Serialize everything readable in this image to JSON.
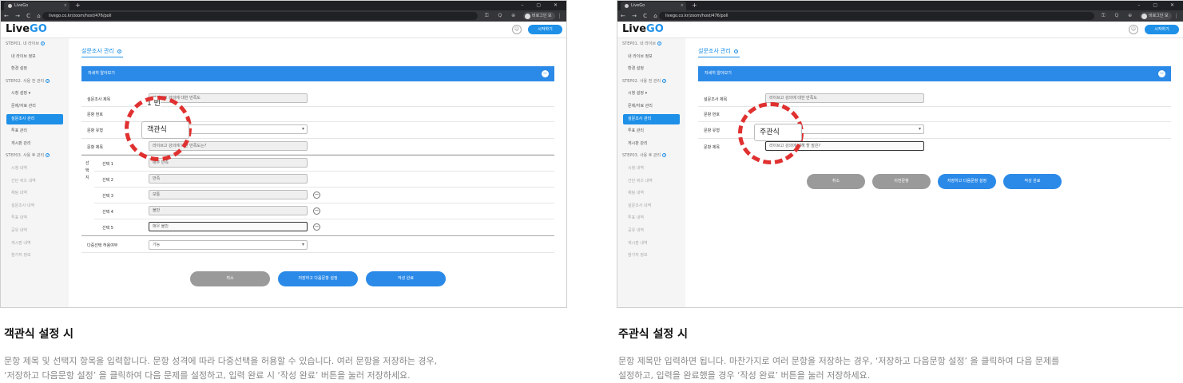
{
  "browser": {
    "tab_title": "LiveGo",
    "new_tab": "+",
    "window_controls": "– ▢ ✕",
    "nav_controls": "← → C ⌂",
    "url_left": "livego.co.kr/zoom/host/476/poll",
    "url_right": "livego.co.kr/zoom/host/476/poll",
    "tool_icons": "⚿ Q ⊕ ☆ ≡",
    "profile_label": "비로그인 모드",
    "menu": "⋮"
  },
  "header": {
    "logo_main": "Live",
    "logo_accent": "GO",
    "user_icon": "user-icon",
    "cta_label": "시작하기"
  },
  "sidebar": {
    "items": [
      {
        "label": "STEP01. 내 라이브",
        "kind": "step",
        "help": "?"
      },
      {
        "label": "내 라이브 정보",
        "kind": "item"
      },
      {
        "label": "환경 설정",
        "kind": "item"
      },
      {
        "label": "STEP02. 사용 전 관리",
        "kind": "step",
        "help": "?"
      },
      {
        "label": "시청 설정 ▾",
        "kind": "item"
      },
      {
        "label": "문제/자료 관리",
        "kind": "item"
      },
      {
        "label": "설문조사 관리",
        "kind": "active"
      },
      {
        "label": "투표 관리",
        "kind": "item"
      },
      {
        "label": "게시판 관리",
        "kind": "item"
      },
      {
        "label": "STEP03. 사용 후 관리",
        "kind": "step",
        "help": "?"
      },
      {
        "label": "시청 내역",
        "kind": "dim"
      },
      {
        "label": "간단 퀴즈 내역",
        "kind": "dim"
      },
      {
        "label": "채팅 내역",
        "kind": "dim"
      },
      {
        "label": "설문조사 내역",
        "kind": "dim"
      },
      {
        "label": "투표 내역",
        "kind": "dim"
      },
      {
        "label": "공유 내역",
        "kind": "dim"
      },
      {
        "label": "게시판 내역",
        "kind": "dim"
      },
      {
        "label": "참가자 정보",
        "kind": "dim"
      }
    ]
  },
  "main": {
    "title": "설문조사 관리",
    "help": "?",
    "section_bar": "자세히 알아보기",
    "section_toggle": "−",
    "labels": {
      "survey_title": "설문조사 제목",
      "q_number": "문항 번호",
      "q_type": "문항 유형",
      "q_title": "문항 제목",
      "choices_vertical": "선택지",
      "multi": "다중선택 허용여부"
    },
    "left": {
      "survey_title_value": "라이브고 강의에 대한 만족도",
      "q_type_value": "객관식",
      "q_title_value": "라이브고 강의에 대한 만족도는?",
      "q_number_overlay": "1",
      "q_number_frag": "번",
      "choices": [
        {
          "label": "선택 1",
          "value": "매우 만족"
        },
        {
          "label": "선택 2",
          "value": "만족"
        },
        {
          "label": "선택 3",
          "value": "보통"
        },
        {
          "label": "선택 4",
          "value": "불만"
        },
        {
          "label": "선택 5",
          "value": "매우 불만"
        }
      ],
      "multi_value": "가능",
      "minus": "−"
    },
    "right": {
      "survey_title_value": "라이브고 강의에 대한 만족도",
      "q_type_value": "주관식",
      "q_title_value": "라이브고 강의에 대해 할 말은?"
    },
    "buttons": {
      "cancel": "취소",
      "prev": "이전문항",
      "save_next": "저장하고 다음문항 설정",
      "done": "작성 완료"
    }
  },
  "captions": {
    "left_title": "객관식 설정 시",
    "left_desc_1": "문항 제목 및 선택지 항목을 입력합니다. 문항 성격에 따라 다중선택을 허용할 수 있습니다. 여러 문항을 저장하는 경우,",
    "left_desc_2": "‘저장하고 다음문항 설정’ 을 클릭하여 다음 문제를 설정하고, 입력 완료 시 ‘작성 완료’ 버튼을 눌러 저장하세요.",
    "right_title": "주관식 설정 시",
    "right_desc_1": "문항 제목만 입력하면 됩니다. 마찬가지로 여러 문항을 저장하는 경우, ‘저장하고 다음문항 설정’ 을 클릭하여 다음 문제를",
    "right_desc_2": "설정하고, 입력을 완료했을 경우 ‘작성 완료’ 버튼을 눌러 저장하세요."
  },
  "colors": {
    "accent": "#1e90e8",
    "highlight": "#e03030",
    "disabled": "#9a9a9a"
  }
}
